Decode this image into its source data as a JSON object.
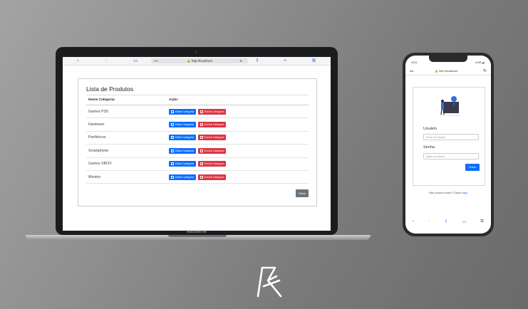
{
  "laptop": {
    "label": "MacBook Air",
    "browser": {
      "back": "‹",
      "forward": "›",
      "aa": "AA",
      "url": "🔒 http://localhost",
      "reload": "↻",
      "share": "⇪",
      "add": "+",
      "tabs": "⧉",
      "bookmarks": "▭"
    },
    "page": {
      "title": "Lista de Produtos",
      "col_name": "Nome Categoria",
      "col_action": "Ação:",
      "edit_label": "Editar Categoria",
      "delete_label": "Excluir Categoria",
      "rows": [
        {
          "name": "Games PS5"
        },
        {
          "name": "Hardware"
        },
        {
          "name": "Periféricos"
        },
        {
          "name": "Smartphone"
        },
        {
          "name": "Games XBOX"
        },
        {
          "name": "Monitor"
        }
      ],
      "back_button": "Voltar"
    }
  },
  "phone": {
    "time": "10:11",
    "status_right": "•ıl 5G ▬",
    "aa": "AA",
    "url": "🔒 http://localhost",
    "reload": "↻",
    "user_label": "Usuário",
    "user_placeholder": "Nome de Usuário",
    "pass_label": "Senha",
    "pass_placeholder": "Digite sua senha",
    "submit": "Entrar",
    "register_text": "Não possui conta? Clique",
    "register_link": "Aqui",
    "nav": {
      "back": "‹",
      "forward": "›",
      "share": "⇪",
      "bookmarks": "▭",
      "tabs": "⧉"
    }
  },
  "colors": {
    "primary": "#0d6efd",
    "danger": "#dc3545",
    "secondary": "#6c757d"
  }
}
